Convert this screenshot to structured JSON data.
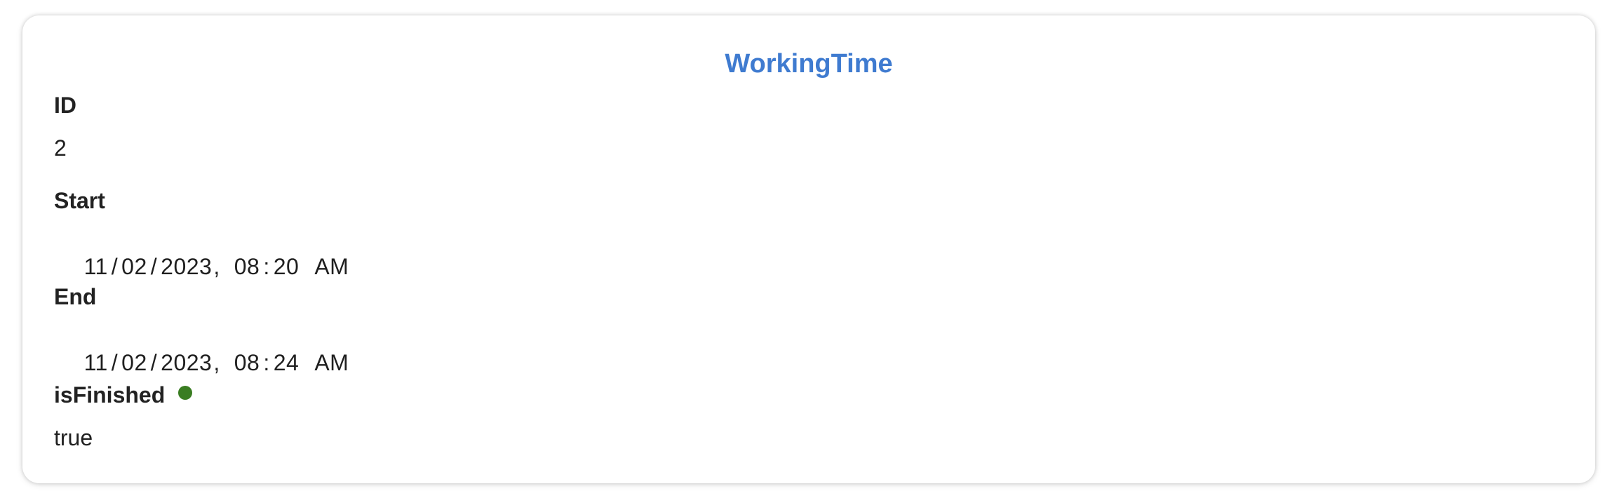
{
  "card": {
    "title": "WorkingTime"
  },
  "fields": {
    "id": {
      "label": "ID",
      "value": "2"
    },
    "start": {
      "label": "Start",
      "month": "11",
      "day": "02",
      "year": "2023",
      "hour": "08",
      "minute": "20",
      "ampm": "AM"
    },
    "end": {
      "label": "End",
      "month": "11",
      "day": "02",
      "year": "2023",
      "hour": "08",
      "minute": "24",
      "ampm": "AM"
    },
    "is_finished": {
      "label": "isFinished",
      "value": "true",
      "indicator_color": "#3a7d22"
    }
  },
  "colors": {
    "title": "#3f7bd0",
    "status_ok": "#3a7d22"
  }
}
